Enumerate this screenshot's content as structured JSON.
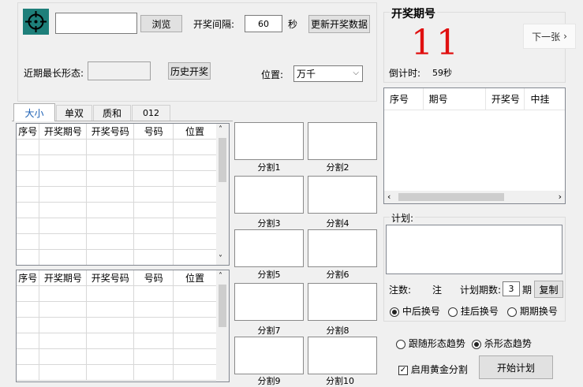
{
  "top": {
    "browse_label": "浏览",
    "interval_label": "开奖间隔:",
    "interval_value": "60",
    "seconds_label": "秒",
    "update_label": "更新开奖数据",
    "longest_pattern_label": "近期最长形态:",
    "history_label": "历史开奖",
    "position_label": "位置:",
    "position_value": "万千"
  },
  "draw": {
    "title": "开奖期号",
    "number": "11",
    "next_label": "下一张",
    "countdown_label": "倒计时:",
    "countdown_value": "59秒"
  },
  "result_table": {
    "headers": [
      "序号",
      "期号",
      "开奖号",
      "中挂"
    ]
  },
  "tabs": [
    "大小",
    "单双",
    "质和",
    "012"
  ],
  "grid_headers": [
    "序号",
    "开奖期号",
    "开奖号码",
    "号码",
    "位置"
  ],
  "splits": [
    "分割1",
    "分割2",
    "分割3",
    "分割4",
    "分割5",
    "分割6",
    "分割7",
    "分割8",
    "分割9",
    "分割10"
  ],
  "plan": {
    "label": "计划:",
    "bets_label": "注数:",
    "bets_value": "注",
    "periods_label": "计划期数:",
    "periods_value": "3",
    "periods_unit": "期",
    "copy_label": "复制",
    "radio1": "中后换号",
    "radio2": "挂后换号",
    "radio3": "期期换号"
  },
  "trend": {
    "follow_label": "跟随形态趋势",
    "kill_label": "杀形态趋势",
    "golden_label": "启用黄金分割",
    "start_label": "开始计划"
  },
  "colors": {
    "number_red": "#e01010",
    "icon_bg": "#1e7f7a"
  }
}
